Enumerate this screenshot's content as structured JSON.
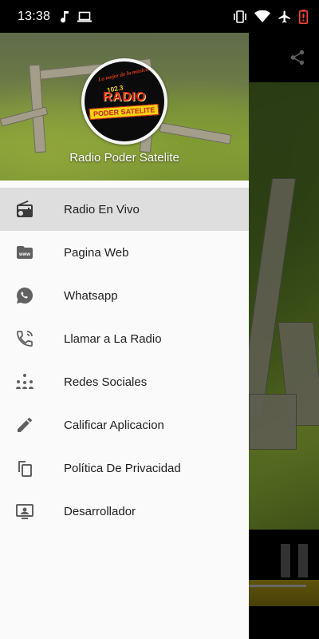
{
  "status_bar": {
    "time": "13:38",
    "left_icons": [
      "music-note-icon",
      "laptop-icon"
    ],
    "right_icons": [
      "vibrate-icon",
      "wifi-icon",
      "airplane-icon",
      "battery-low-icon"
    ],
    "battery_color": "#f44336"
  },
  "drawer": {
    "header": {
      "station_name": "Radio Poder Satelite",
      "logo": {
        "arc_text": "Lo mejor de la música en tu radio",
        "frequency": "102.3",
        "word": "RADIO",
        "banner": "PODER SATELITE"
      }
    },
    "items": [
      {
        "label": "Radio En Vivo",
        "icon": "radio-icon",
        "selected": true
      },
      {
        "label": "Pagina Web",
        "icon": "www-folder-icon",
        "selected": false
      },
      {
        "label": "Whatsapp",
        "icon": "whatsapp-icon",
        "selected": false
      },
      {
        "label": "Llamar a La Radio",
        "icon": "phone-call-icon",
        "selected": false
      },
      {
        "label": "Redes Sociales",
        "icon": "social-network-icon",
        "selected": false
      },
      {
        "label": "Calificar Aplicacion",
        "icon": "pencil-icon",
        "selected": false
      },
      {
        "label": "Política De Privacidad",
        "icon": "copy-documents-icon",
        "selected": false
      },
      {
        "label": "Desarrollador",
        "icon": "developer-screen-icon",
        "selected": false
      }
    ]
  },
  "background_app": {
    "toolbar_icon": "share-icon",
    "player_icon": "pause-icon"
  },
  "colors": {
    "drawer_bg": "#fafafa",
    "selected_item_bg": "#dedede",
    "icon_gray": "#616161",
    "text": "#1e1e1e"
  }
}
